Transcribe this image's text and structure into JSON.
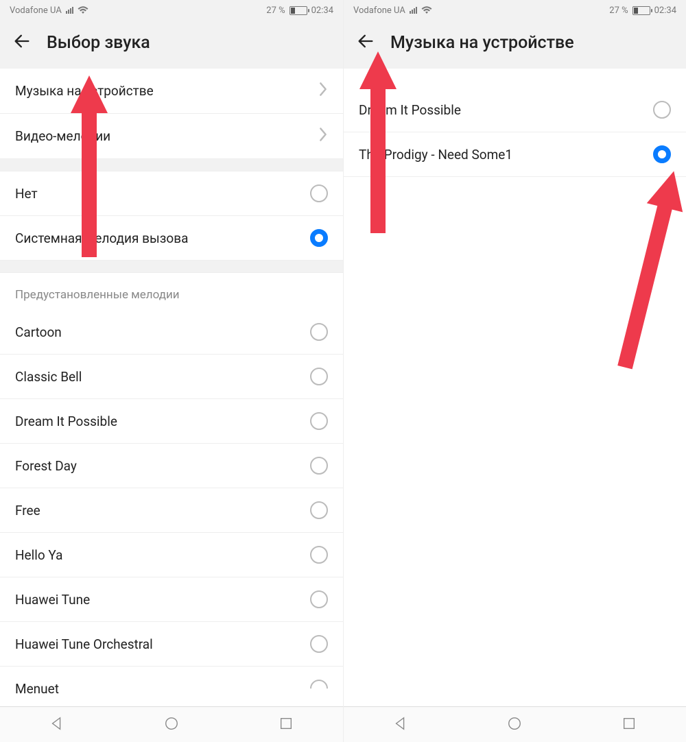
{
  "status": {
    "carrier": "Vodafone UA",
    "battery_pct": "27 %",
    "time": "02:34"
  },
  "left": {
    "title": "Выбор звука",
    "nav_items": [
      {
        "label": "Музыка на устройстве"
      },
      {
        "label": "Видео-мелодии"
      }
    ],
    "basic_items": [
      {
        "label": "Нет",
        "selected": false
      },
      {
        "label": "Системная мелодия вызова",
        "selected": true
      }
    ],
    "section_header": "Предустановленные мелодии",
    "preset_items": [
      {
        "label": "Cartoon",
        "selected": false
      },
      {
        "label": "Classic Bell",
        "selected": false
      },
      {
        "label": "Dream It Possible",
        "selected": false
      },
      {
        "label": "Forest Day",
        "selected": false
      },
      {
        "label": "Free",
        "selected": false
      },
      {
        "label": "Hello Ya",
        "selected": false
      },
      {
        "label": "Huawei Tune",
        "selected": false
      },
      {
        "label": "Huawei Tune Orchestral",
        "selected": false
      },
      {
        "label": "Menuet",
        "selected": false
      }
    ]
  },
  "right": {
    "title": "Музыка на устройстве",
    "items": [
      {
        "label": "Dream It Possible",
        "selected": false
      },
      {
        "label": "The Prodigy - Need Some1",
        "selected": true
      }
    ]
  },
  "colors": {
    "accent": "#0a7cff",
    "annotation": "#ee3a4c"
  }
}
